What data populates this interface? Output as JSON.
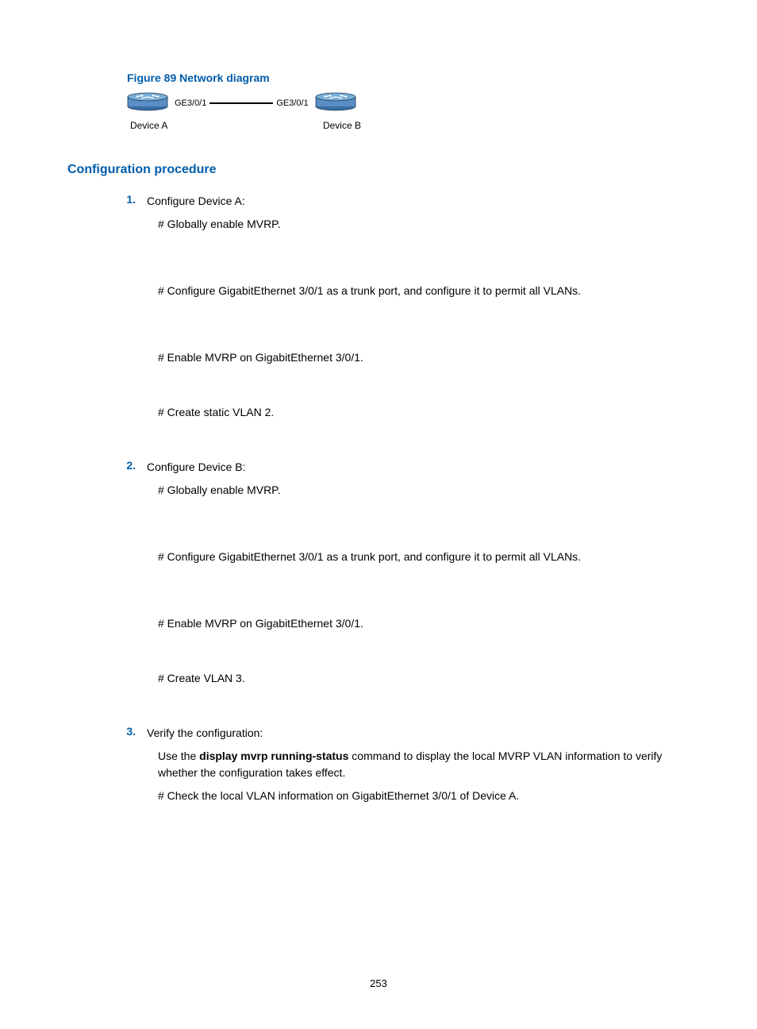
{
  "figure_title": "Figure 89 Network diagram",
  "diagram": {
    "left_interface": "GE3/0/1",
    "right_interface": "GE3/0/1",
    "left_device": "Device A",
    "right_device": "Device B"
  },
  "section_heading": "Configuration procedure",
  "steps": [
    {
      "number": "1.",
      "title": "Configure Device A:",
      "lines": [
        "# Globally enable MVRP.",
        "# Configure GigabitEthernet 3/0/1 as a trunk port, and configure it to permit all VLANs.",
        "# Enable MVRP on GigabitEthernet 3/0/1.",
        "# Create static VLAN 2."
      ]
    },
    {
      "number": "2.",
      "title": "Configure Device B:",
      "lines": [
        "# Globally enable MVRP.",
        "# Configure GigabitEthernet 3/0/1 as a trunk port, and configure it to permit all VLANs.",
        "# Enable MVRP on GigabitEthernet 3/0/1.",
        "# Create VLAN 3."
      ]
    },
    {
      "number": "3.",
      "title": "Verify the configuration:",
      "verify": {
        "preText": "Use the ",
        "boldText": "display mvrp running-status",
        "postText": " command to display the local MVRP VLAN information to verify whether the configuration takes effect."
      },
      "check_line": "# Check the local VLAN information on GigabitEthernet 3/0/1 of Device A."
    }
  ],
  "page_number": "253"
}
